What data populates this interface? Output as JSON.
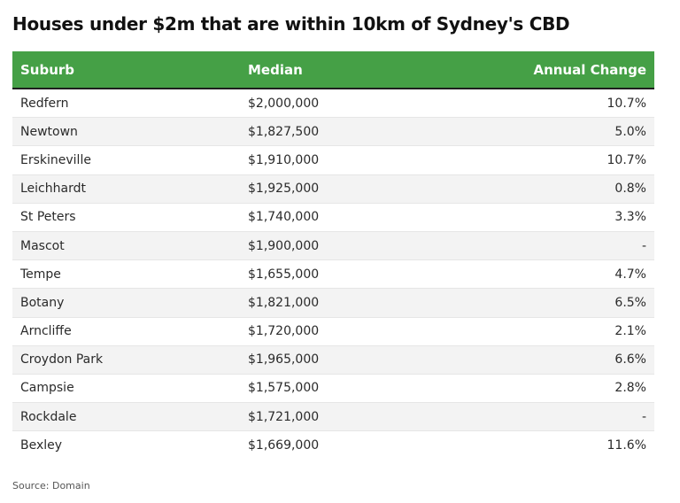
{
  "title": "Houses under $2m that are within 10km of Sydney's CBD",
  "source": "Source: Domain",
  "colors": {
    "header_bg": "#45a046",
    "header_text": "#ffffff",
    "row_alt_bg": "#f3f3f3"
  },
  "chart_data": {
    "type": "table",
    "title": "Houses under $2m that are within 10km of Sydney's CBD",
    "columns": [
      "Suburb",
      "Median",
      "Annual Change"
    ],
    "rows": [
      [
        "Redfern",
        "$2,000,000",
        "10.7%"
      ],
      [
        "Newtown",
        "$1,827,500",
        "5.0%"
      ],
      [
        "Erskineville",
        "$1,910,000",
        "10.7%"
      ],
      [
        "Leichhardt",
        "$1,925,000",
        "0.8%"
      ],
      [
        "St Peters",
        "$1,740,000",
        "3.3%"
      ],
      [
        "Mascot",
        "$1,900,000",
        "-"
      ],
      [
        "Tempe",
        "$1,655,000",
        "4.7%"
      ],
      [
        "Botany",
        "$1,821,000",
        "6.5%"
      ],
      [
        "Arncliffe",
        "$1,720,000",
        "2.1%"
      ],
      [
        "Croydon Park",
        "$1,965,000",
        "6.6%"
      ],
      [
        "Campsie",
        "$1,575,000",
        "2.8%"
      ],
      [
        "Rockdale",
        "$1,721,000",
        "-"
      ],
      [
        "Bexley",
        "$1,669,000",
        "11.6%"
      ]
    ]
  }
}
